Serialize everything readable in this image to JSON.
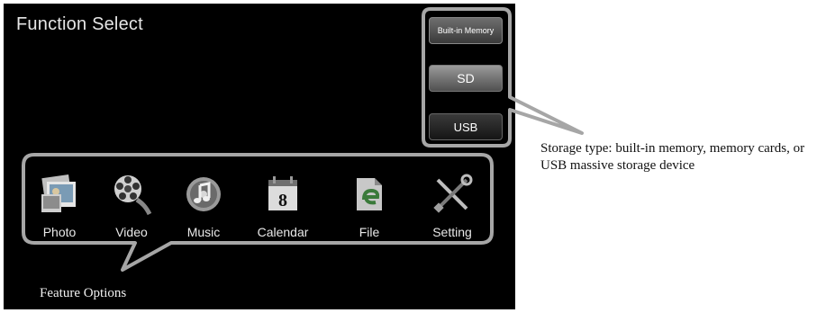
{
  "screen": {
    "title": "Function Select"
  },
  "storage": {
    "builtin_label": "Built-in Memory",
    "sd_label": "SD",
    "usb_label": "USB"
  },
  "features": [
    {
      "label": "Photo",
      "icon": "photo-icon"
    },
    {
      "label": "Video",
      "icon": "film-reel-icon"
    },
    {
      "label": "Music",
      "icon": "music-disc-icon"
    },
    {
      "label": "Calendar",
      "icon": "calendar-icon"
    },
    {
      "label": "File",
      "icon": "file-icon"
    },
    {
      "label": "Setting",
      "icon": "tools-icon"
    }
  ],
  "calendar_day": "8",
  "annotations": {
    "storage_caption": "Storage type: built-in memory, memory cards, or USB massive storage device",
    "feature_caption": "Feature Options"
  },
  "colors": {
    "callout": "#a6a6a6",
    "screen_bg": "#000000"
  }
}
